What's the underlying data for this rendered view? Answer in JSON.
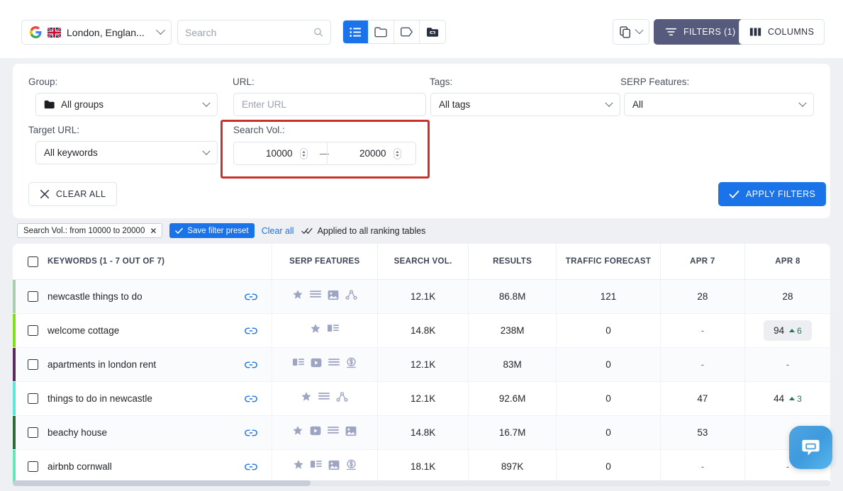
{
  "toolbar": {
    "location": "London, Englan...",
    "search_placeholder": "Search",
    "views": [
      {
        "name": "list-view",
        "icon": "list-icon",
        "active": true
      },
      {
        "name": "folder-view",
        "icon": "folder-icon",
        "active": false
      },
      {
        "name": "tag-view",
        "icon": "tag-icon",
        "active": false
      },
      {
        "name": "linked-folder-view",
        "icon": "linked-folder-icon",
        "active": false
      }
    ],
    "copy_label": "",
    "filters_label": "FILTERS (1)",
    "columns_label": "COLUMNS"
  },
  "filters": {
    "group": {
      "label": "Group:",
      "value": "All groups"
    },
    "url": {
      "label": "URL:",
      "placeholder": "Enter URL",
      "value": ""
    },
    "tags": {
      "label": "Tags:",
      "value": "All tags"
    },
    "serp_features": {
      "label": "SERP Features:",
      "value": "All"
    },
    "target_url": {
      "label": "Target URL:",
      "value": "All keywords"
    },
    "search_vol": {
      "label": "Search Vol.:",
      "min": "10000",
      "max": "20000",
      "separator": "—"
    },
    "clear_all_label": "CLEAR ALL",
    "apply_label": "APPLY FILTERS"
  },
  "chips": {
    "active_filter": "Search Vol.: from 10000 to 20000",
    "save_preset": "Save filter preset",
    "clear_all": "Clear all",
    "applied_note": "Applied to all ranking tables"
  },
  "table": {
    "columns": [
      "KEYWORDS (1 - 7 OUT OF 7)",
      "SERP FEATURES",
      "SEARCH VOL.",
      "RESULTS",
      "TRAFFIC FORECAST",
      "APR 7",
      "APR 8"
    ],
    "rows": [
      {
        "bar_color": "#a8ceb0",
        "keyword": "newcastle things to do",
        "serp": [
          "star-icon",
          "list-icon",
          "image-icon",
          "dots-graph-icon"
        ],
        "search_vol": "12.1K",
        "results": "86.8M",
        "traffic_forecast": "121",
        "apr7": "28",
        "apr8": "28",
        "apr8_delta": "",
        "apr8_highlight": false
      },
      {
        "bar_color": "#7ee017",
        "keyword": "welcome cottage",
        "serp": [
          "star-icon",
          "snippet-icon"
        ],
        "search_vol": "14.8K",
        "results": "238M",
        "traffic_forecast": "0",
        "apr7": "-",
        "apr8": "94",
        "apr8_delta": "6",
        "apr8_highlight": true
      },
      {
        "bar_color": "#5b2b60",
        "keyword": "apartments in london rent",
        "serp": [
          "snippet-icon",
          "video-icon",
          "list-icon",
          "money-icon"
        ],
        "search_vol": "12.1K",
        "results": "83M",
        "traffic_forecast": "0",
        "apr7": "-",
        "apr8": "-",
        "apr8_delta": "",
        "apr8_highlight": false
      },
      {
        "bar_color": "#5ce8d8",
        "keyword": "things to do in newcastle",
        "serp": [
          "star-icon",
          "list-icon",
          "dots-graph-icon"
        ],
        "search_vol": "12.1K",
        "results": "92.6M",
        "traffic_forecast": "0",
        "apr7": "47",
        "apr8": "44",
        "apr8_delta": "3",
        "apr8_highlight": false
      },
      {
        "bar_color": "#2f6b38",
        "keyword": "beachy house",
        "serp": [
          "star-icon",
          "video-icon",
          "list-icon",
          "image-icon"
        ],
        "search_vol": "14.8K",
        "results": "16.7M",
        "traffic_forecast": "0",
        "apr7": "53",
        "apr8": "",
        "apr8_delta": "",
        "apr8_highlight": false
      },
      {
        "bar_color": "#62e8b8",
        "keyword": "airbnb cornwall",
        "serp": [
          "star-icon",
          "snippet-icon",
          "image-icon",
          "money-icon"
        ],
        "search_vol": "18.1K",
        "results": "897K",
        "traffic_forecast": "0",
        "apr7": "-",
        "apr8": "-",
        "apr8_delta": "",
        "apr8_highlight": false
      }
    ]
  },
  "colors": {
    "accent_blue": "#1a73e8",
    "filters_purple": "#565a7c",
    "highlight_red": "#c8322a",
    "delta_up_green": "#1f7a4d"
  }
}
